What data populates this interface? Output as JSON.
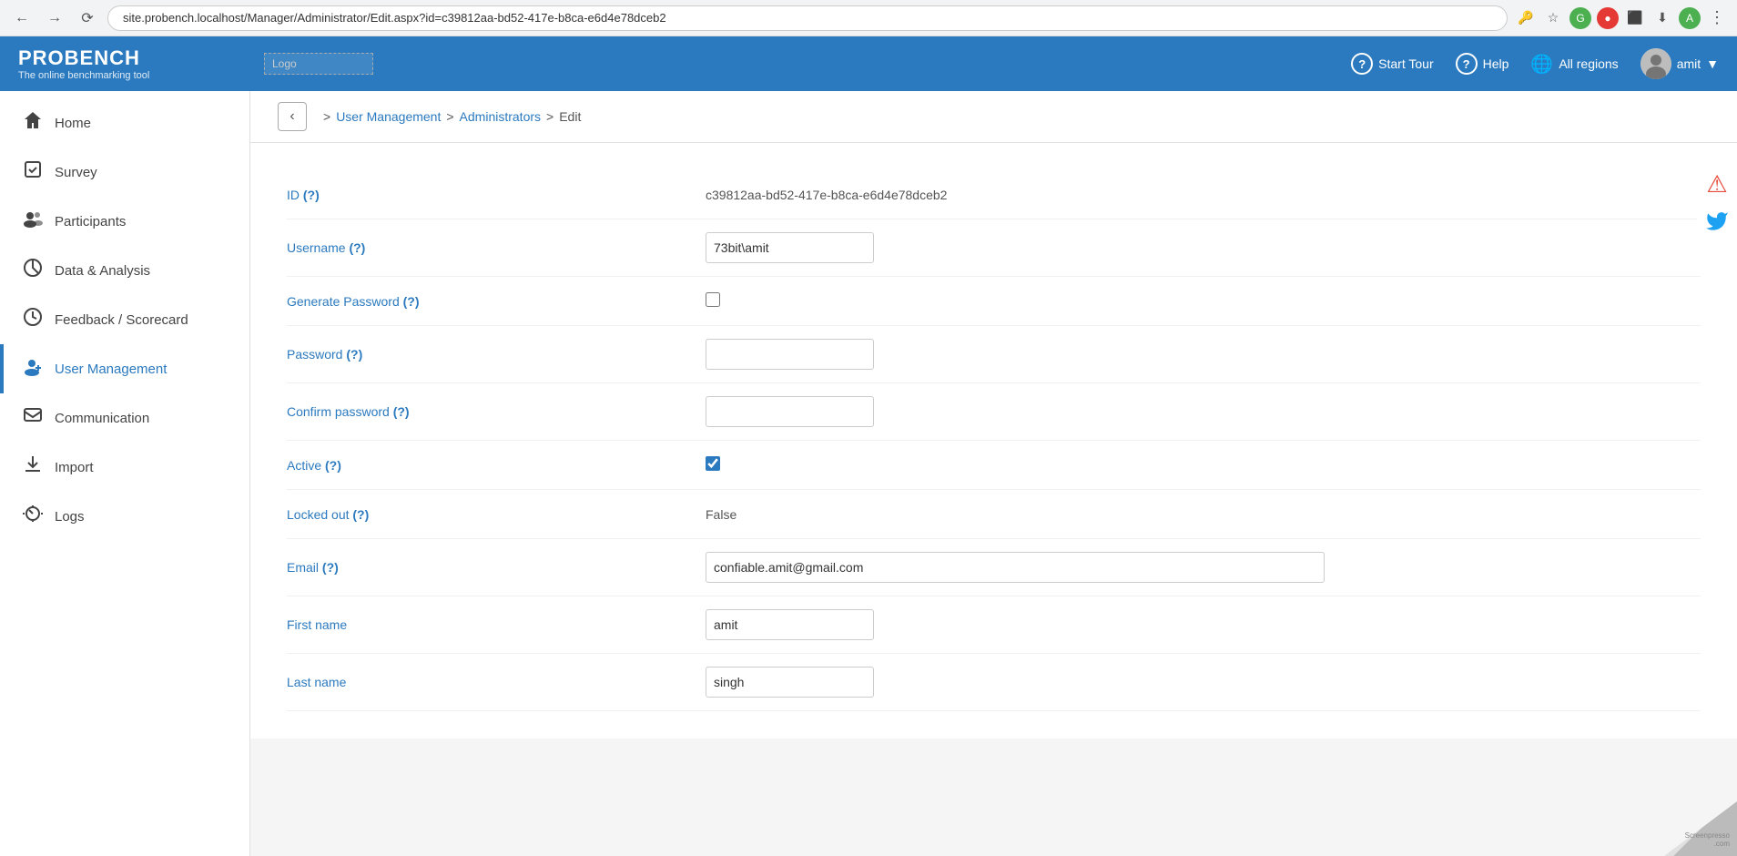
{
  "browser": {
    "url": "site.probench.localhost/Manager/Administrator/Edit.aspx?id=c39812aa-bd52-417e-b8ca-e6d4e78dceb2"
  },
  "header": {
    "brand_title": "PROBENCH",
    "brand_subtitle": "The online benchmarking tool",
    "logo_text": "Logo",
    "start_tour_label": "Start Tour",
    "help_label": "Help",
    "all_regions_label": "All regions",
    "user_label": "amit"
  },
  "sidebar": {
    "items": [
      {
        "id": "home",
        "label": "Home",
        "icon": "⌂",
        "active": false
      },
      {
        "id": "survey",
        "label": "Survey",
        "icon": "✓",
        "active": false
      },
      {
        "id": "participants",
        "label": "Participants",
        "icon": "👥",
        "active": false
      },
      {
        "id": "data-analysis",
        "label": "Data & Analysis",
        "icon": "⚲",
        "active": false
      },
      {
        "id": "feedback-scorecard",
        "label": "Feedback / Scorecard",
        "icon": "◕",
        "active": false
      },
      {
        "id": "user-management",
        "label": "User Management",
        "icon": "👤+",
        "active": true
      },
      {
        "id": "communication",
        "label": "Communication",
        "icon": "✉",
        "active": false
      },
      {
        "id": "import",
        "label": "Import",
        "icon": "⬆",
        "active": false
      },
      {
        "id": "logs",
        "label": "Logs",
        "icon": "↺",
        "active": false
      }
    ]
  },
  "breadcrumb": {
    "items": [
      {
        "label": "User Management",
        "link": true
      },
      {
        "label": "Administrators",
        "link": true
      },
      {
        "label": "Edit",
        "link": false
      }
    ]
  },
  "form": {
    "fields": [
      {
        "id": "id",
        "label": "ID",
        "help": "(?)",
        "value": "c39812aa-bd52-417e-b8ca-e6d4e78dceb2",
        "type": "static"
      },
      {
        "id": "username",
        "label": "Username",
        "help": "(?)",
        "value": "73bit\\amit",
        "type": "input"
      },
      {
        "id": "generate-password",
        "label": "Generate Password",
        "help": "(?)",
        "checked": false,
        "type": "checkbox"
      },
      {
        "id": "password",
        "label": "Password",
        "help": "(?)",
        "value": "",
        "type": "password"
      },
      {
        "id": "confirm-password",
        "label": "Confirm password",
        "help": "(?)",
        "value": "",
        "type": "password"
      },
      {
        "id": "active",
        "label": "Active",
        "help": "(?)",
        "checked": true,
        "type": "checkbox"
      },
      {
        "id": "locked-out",
        "label": "Locked out",
        "help": "(?)",
        "value": "False",
        "type": "static"
      },
      {
        "id": "email",
        "label": "Email",
        "help": "(?)",
        "value": "confiable.amit@gmail.com",
        "type": "input-wide"
      },
      {
        "id": "first-name",
        "label": "First name",
        "value": "amit",
        "type": "input"
      },
      {
        "id": "last-name",
        "label": "Last name",
        "value": "singh",
        "type": "input"
      }
    ]
  }
}
